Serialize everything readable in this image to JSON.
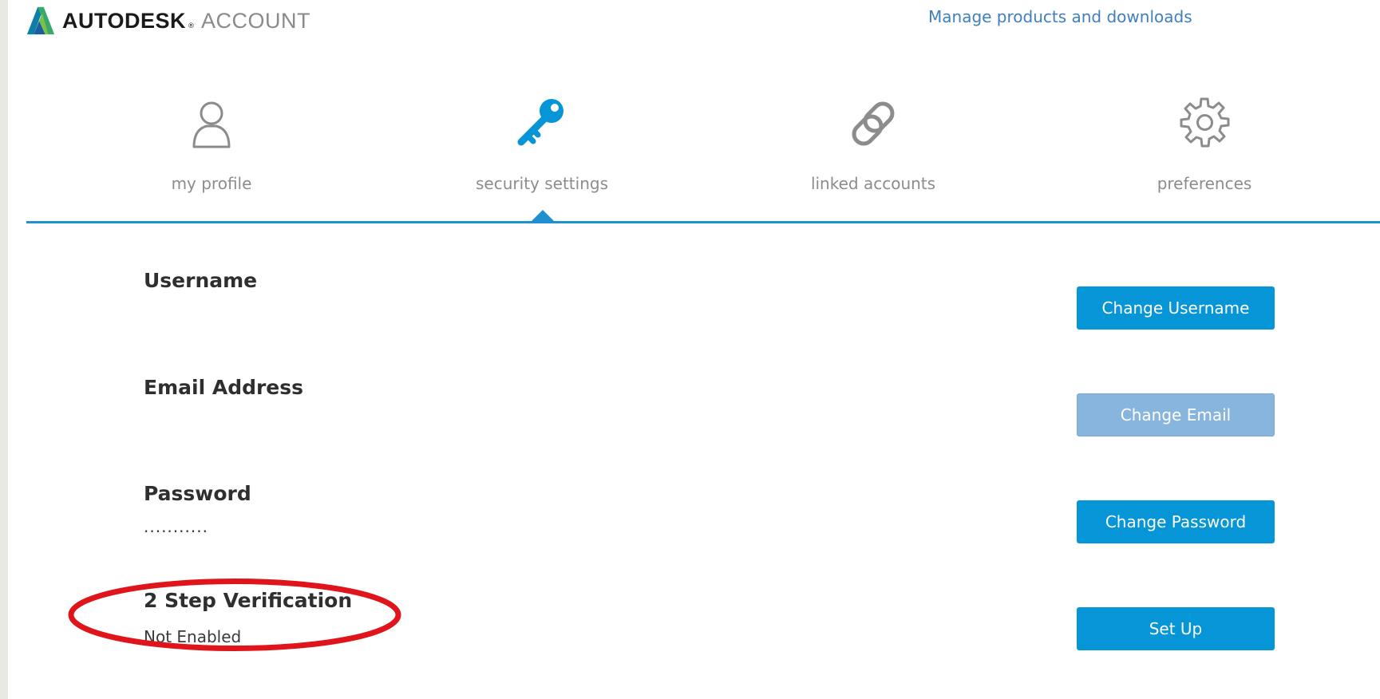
{
  "header": {
    "brand": "AUTODESK",
    "brand_mark": "®",
    "product": "ACCOUNT",
    "manage_link": "Manage products and downloads"
  },
  "tabs": [
    {
      "label": "my profile",
      "icon": "user-icon",
      "active": false
    },
    {
      "label": "security settings",
      "icon": "key-icon",
      "active": true
    },
    {
      "label": "linked accounts",
      "icon": "chain-link-icon",
      "active": false
    },
    {
      "label": "preferences",
      "icon": "gear-icon",
      "active": false
    }
  ],
  "sections": {
    "username": {
      "title": "Username",
      "value": "",
      "button": "Change Username"
    },
    "email": {
      "title": "Email Address",
      "value": "",
      "button": "Change Email",
      "button_disabled": true
    },
    "password": {
      "title": "Password",
      "value": "...........",
      "button": "Change Password"
    },
    "two_step": {
      "title": "2 Step Verification",
      "value": "Not Enabled",
      "button": "Set Up"
    }
  },
  "colors": {
    "accent": "#0696d7",
    "accent_disabled": "#87b5dd",
    "divider": "#1e8fd0",
    "link": "#3f7fbf",
    "annotation": "#e0151b"
  }
}
